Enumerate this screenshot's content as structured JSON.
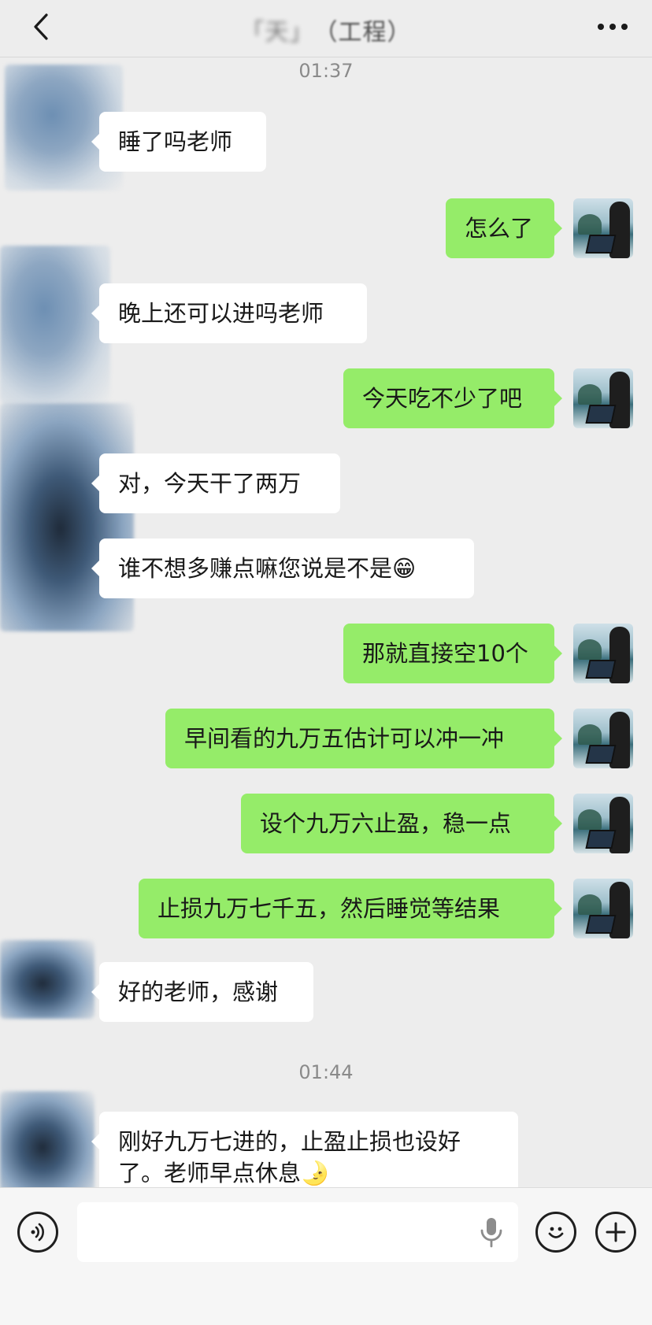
{
  "header": {
    "title": "「天」",
    "title_suffix": "（工程）"
  },
  "timestamps": [
    "01:37",
    "01:44"
  ],
  "messages": [
    {
      "side": "in",
      "text": "睡了吗老师"
    },
    {
      "side": "out",
      "text": "怎么了"
    },
    {
      "side": "in",
      "text": "晚上还可以进吗老师"
    },
    {
      "side": "out",
      "text": "今天吃不少了吧"
    },
    {
      "side": "in",
      "text": "对，今天干了两万"
    },
    {
      "side": "in",
      "text": "谁不想多赚点嘛您说是不是😁"
    },
    {
      "side": "out",
      "text": "那就直接空10个"
    },
    {
      "side": "out",
      "text": "早间看的九万五估计可以冲一冲"
    },
    {
      "side": "out",
      "text": "设个九万六止盈，稳一点"
    },
    {
      "side": "out",
      "text": "止损九万七千五，然后睡觉等结果"
    },
    {
      "side": "in",
      "text": "好的老师，感谢"
    },
    {
      "side": "in",
      "text": "刚好九万七进的，止盈止损也设好了。老师早点休息🌛"
    }
  ],
  "input": {
    "value": "",
    "placeholder": ""
  },
  "icons": {
    "back": "back-chevron-icon",
    "more": "more-dots-icon",
    "voice": "voice-icon",
    "mic": "microphone-icon",
    "emoji": "emoji-icon",
    "plus": "plus-icon"
  },
  "colors": {
    "background": "#ededed",
    "outgoing_bubble": "#95ec69",
    "incoming_bubble": "#ffffff",
    "timestamp": "#8a8a8a"
  }
}
